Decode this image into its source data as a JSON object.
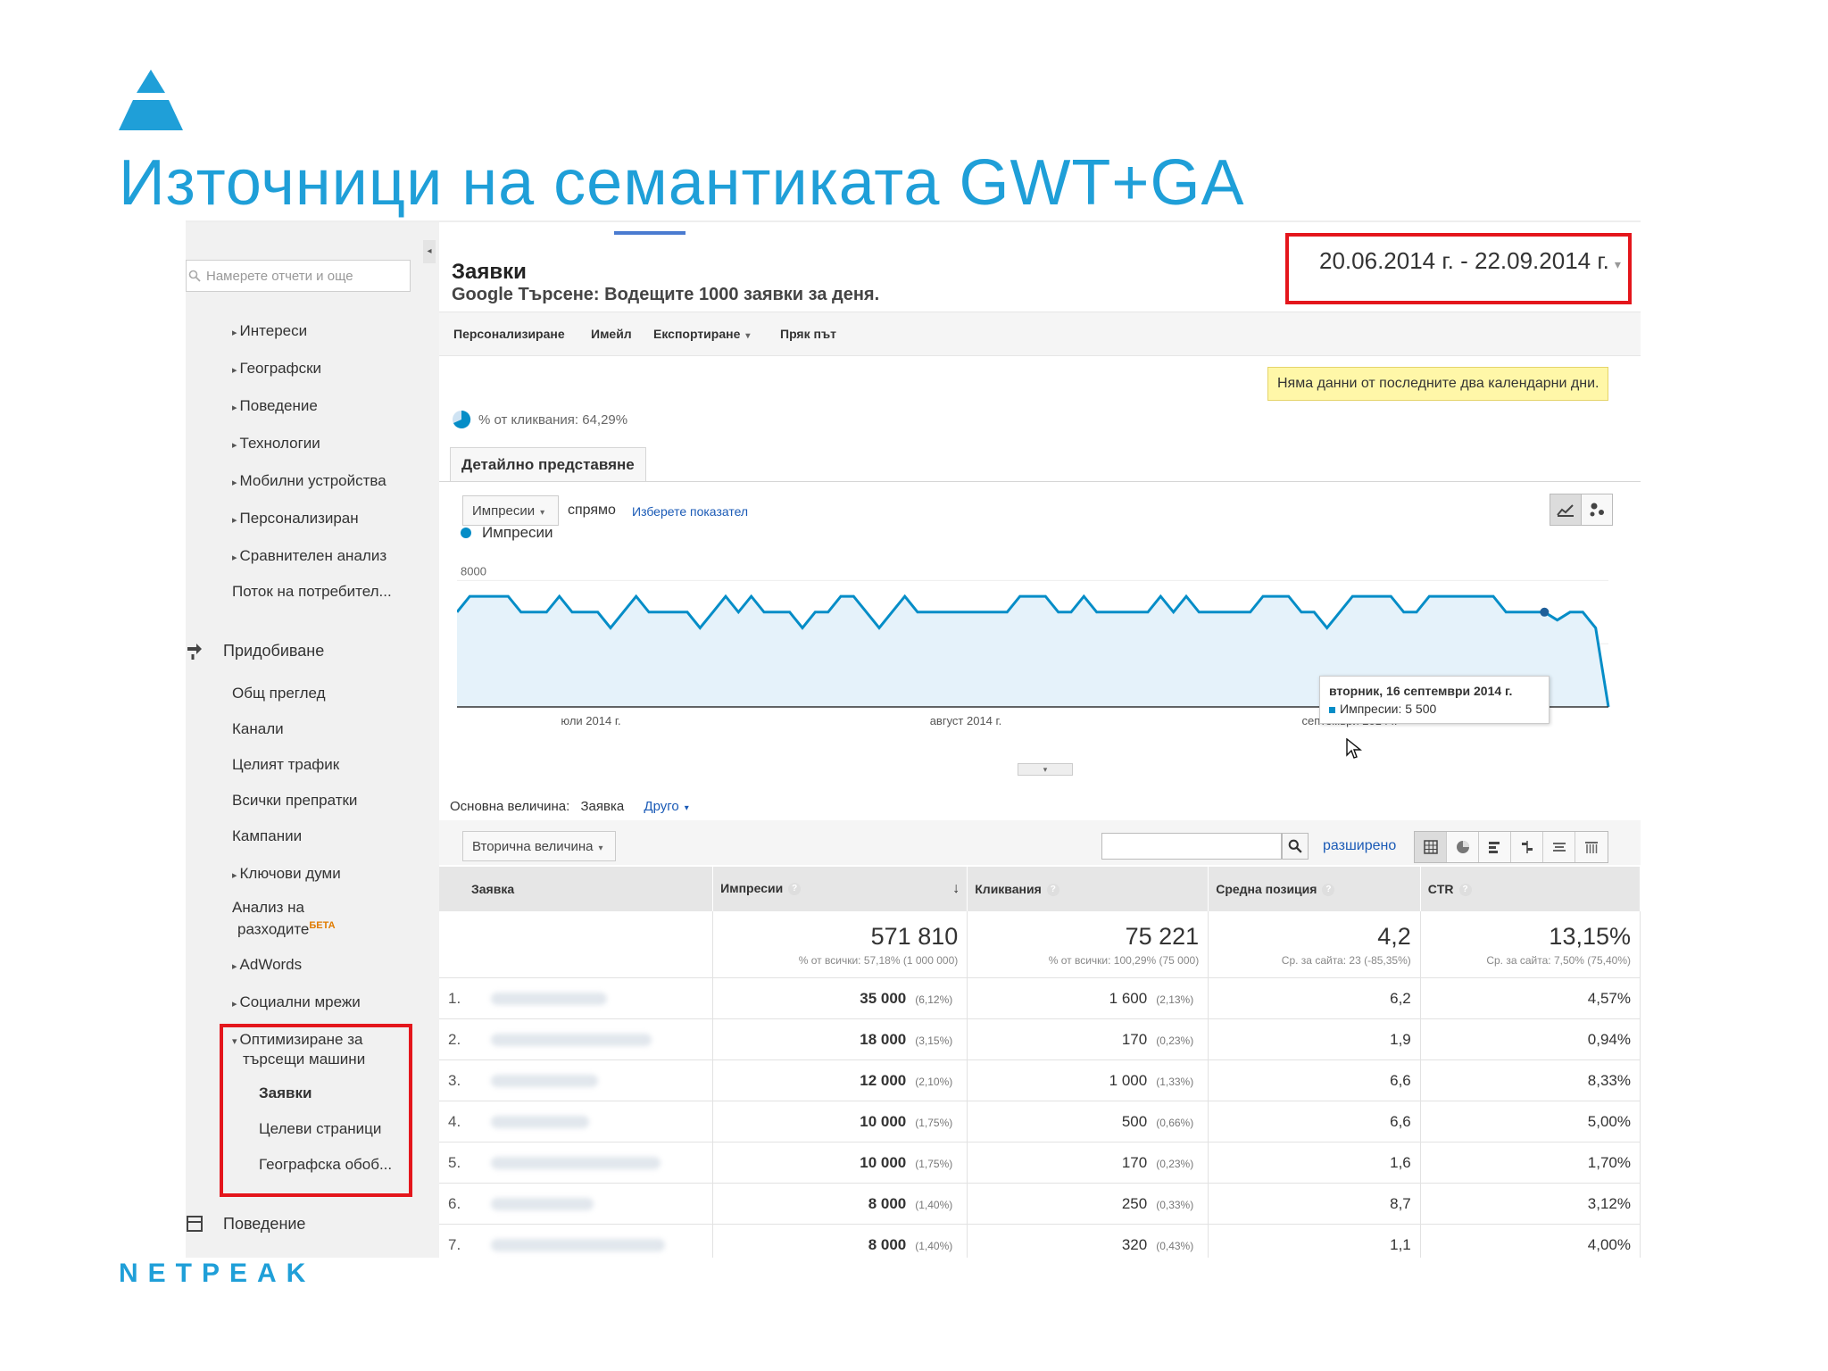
{
  "slide": {
    "title": "Източници на семантиката GWT+GA",
    "brand": "NETPEAK",
    "accent_color": "#1f9fd8",
    "highlight_color": "#e4161c"
  },
  "sidebar": {
    "search_placeholder": "Намерете отчети и още",
    "collapse_arrow": "◂",
    "audience_items": [
      {
        "label": "Интереси",
        "arrow": "▸"
      },
      {
        "label": "Географски",
        "arrow": "▸"
      },
      {
        "label": "Поведение",
        "arrow": "▸"
      },
      {
        "label": "Технологии",
        "arrow": "▸"
      },
      {
        "label": "Мобилни устройства",
        "arrow": "▸"
      },
      {
        "label": "Персонализиран",
        "arrow": "▸"
      },
      {
        "label": "Сравнителен анализ",
        "arrow": "▸"
      },
      {
        "label": "Поток на потребител...",
        "arrow": ""
      }
    ],
    "acquisition_label": "Придобиване",
    "acquisition_items": [
      {
        "label": "Общ преглед",
        "arrow": ""
      },
      {
        "label": "Канали",
        "arrow": ""
      },
      {
        "label": "Целият трафик",
        "arrow": ""
      },
      {
        "label": "Всички препратки",
        "arrow": ""
      },
      {
        "label": "Кампании",
        "arrow": ""
      },
      {
        "label": "Ключови думи",
        "arrow": "▸"
      }
    ],
    "cost_analysis_1": "Анализ на",
    "cost_analysis_2": "разходите",
    "beta": "БЕТА",
    "adwords": "AdWords",
    "social": "Социални мрежи",
    "seo_1": "Оптимизиране за",
    "seo_2": "търсещи машини",
    "seo_queries": "Заявки",
    "seo_landing": "Целеви страници",
    "seo_geo": "Географска обоб...",
    "behavior_label": "Поведение"
  },
  "report": {
    "title": "Заявки",
    "subtitle": "Google Търсене: Водещите 1000 заявки за деня.",
    "date_range": "20.06.2014 г. - 22.09.2014 г.",
    "toolbar": [
      "Персонализиране",
      "Имейл",
      "Експортиране",
      "Пряк път"
    ],
    "notice": "Няма данни от последните два календарни дни.",
    "clicks_pct": "% от кликвания: 64,29%",
    "tab_label": "Детайлно представяне",
    "metric_select": "Импресии",
    "vs_label": "спрямо",
    "choose_metric": "Изберете показател",
    "primary_dim_label": "Основна величина:",
    "primary_dim_value": "Заявка",
    "other_link": "Друго",
    "secondary_dim": "Вторична величина",
    "advanced": "разширено"
  },
  "chart_data": {
    "type": "area",
    "series": [
      {
        "name": "Импресии",
        "color": "#058dc7"
      }
    ],
    "y_ticks": [
      "8000",
      "4000"
    ],
    "ylim": [
      0,
      10000
    ],
    "x_labels": [
      "юли 2014 г.",
      "август 2014 г.",
      "септември 2014 г."
    ],
    "values": [
      6000,
      7000,
      7000,
      7000,
      7000,
      6000,
      6000,
      6000,
      7000,
      6000,
      6000,
      6000,
      5000,
      6000,
      7000,
      6000,
      6000,
      6000,
      6000,
      5000,
      6000,
      7000,
      6000,
      7000,
      6000,
      6000,
      6000,
      5000,
      6000,
      6000,
      7000,
      7000,
      6000,
      5000,
      6000,
      7000,
      6000,
      6000,
      6000,
      6000,
      6000,
      6000,
      6000,
      6000,
      7000,
      7000,
      7000,
      6000,
      6000,
      7000,
      6000,
      6000,
      6000,
      6000,
      6000,
      7000,
      6000,
      7000,
      6000,
      6000,
      6000,
      6000,
      6000,
      7000,
      7000,
      7000,
      6000,
      6000,
      5000,
      6000,
      7000,
      7000,
      7000,
      7000,
      6000,
      6000,
      7000,
      7000,
      7000,
      7000,
      7000,
      7000,
      6000,
      6000,
      6000,
      6000,
      5500,
      6000,
      6000,
      5000,
      0
    ],
    "tooltip_title": "вторник, 16 септември 2014 г.",
    "tooltip_value": "Импресии: 5 500"
  },
  "table": {
    "headers": [
      "Заявка",
      "Импресии",
      "Кликвания",
      "Средна позиция",
      "CTR"
    ],
    "totals": [
      {
        "value": "571 810",
        "sub": "% от всички: 57,18% (1 000 000)"
      },
      {
        "value": "75 221",
        "sub": "% от всички: 100,29% (75 000)"
      },
      {
        "value": "4,2",
        "sub": "Ср. за сайта: 23 (-85,35%)"
      },
      {
        "value": "13,15%",
        "sub": "Ср. за сайта: 7,50% (75,40%)"
      }
    ],
    "rows": [
      {
        "n": "1.",
        "impr": "35 000",
        "impr_pct": "(6,12%)",
        "clicks": "1 600",
        "clicks_pct": "(2,13%)",
        "pos": "6,2",
        "ctr": "4,57%"
      },
      {
        "n": "2.",
        "impr": "18 000",
        "impr_pct": "(3,15%)",
        "clicks": "170",
        "clicks_pct": "(0,23%)",
        "pos": "1,9",
        "ctr": "0,94%"
      },
      {
        "n": "3.",
        "impr": "12 000",
        "impr_pct": "(2,10%)",
        "clicks": "1 000",
        "clicks_pct": "(1,33%)",
        "pos": "6,6",
        "ctr": "8,33%"
      },
      {
        "n": "4.",
        "impr": "10 000",
        "impr_pct": "(1,75%)",
        "clicks": "500",
        "clicks_pct": "(0,66%)",
        "pos": "6,6",
        "ctr": "5,00%"
      },
      {
        "n": "5.",
        "impr": "10 000",
        "impr_pct": "(1,75%)",
        "clicks": "170",
        "clicks_pct": "(0,23%)",
        "pos": "1,6",
        "ctr": "1,70%"
      },
      {
        "n": "6.",
        "impr": "8 000",
        "impr_pct": "(1,40%)",
        "clicks": "250",
        "clicks_pct": "(0,33%)",
        "pos": "8,7",
        "ctr": "3,12%"
      },
      {
        "n": "7.",
        "impr": "8 000",
        "impr_pct": "(1,40%)",
        "clicks": "320",
        "clicks_pct": "(0,43%)",
        "pos": "1,1",
        "ctr": "4,00%"
      }
    ]
  }
}
